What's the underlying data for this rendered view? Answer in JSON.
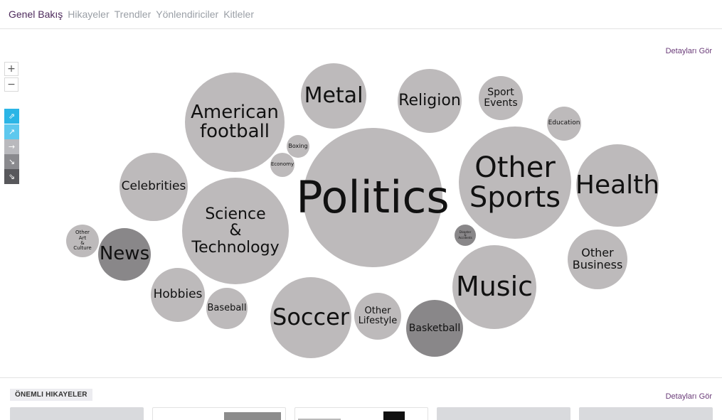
{
  "nav": {
    "tabs": [
      {
        "label": "Genel Bakış",
        "active": true
      },
      {
        "label": "Hikayeler",
        "active": false
      },
      {
        "label": "Trendler",
        "active": false
      },
      {
        "label": "Yönlendiriciler",
        "active": false
      },
      {
        "label": "Kitleler",
        "active": false
      }
    ]
  },
  "bubble_map": {
    "details_label": "Detayları Gör",
    "zoom_in_icon": "plus-icon",
    "zoom_out_icon": "minus-icon",
    "trend_legend": [
      {
        "icon": "arrow-up-strong-icon",
        "color": "#2bb5e6"
      },
      {
        "icon": "arrow-up-icon",
        "color": "#5ec8ee"
      },
      {
        "icon": "arrow-flat-icon",
        "color": "#b9b9bd"
      },
      {
        "icon": "arrow-down-icon",
        "color": "#8a8a8e"
      },
      {
        "icon": "arrow-down-strong-icon",
        "color": "#58585c"
      }
    ],
    "topics": [
      {
        "label": "Politics",
        "tone": "#bdbabb"
      },
      {
        "label": "Other\nSports",
        "tone": "#bdbabb"
      },
      {
        "label": "American\nfootball",
        "tone": "#bdbabb"
      },
      {
        "label": "Science\n&\nTechnology",
        "tone": "#bdbabb"
      },
      {
        "label": "Soccer",
        "tone": "#bdbabb"
      },
      {
        "label": "Music",
        "tone": "#bdbabb"
      },
      {
        "label": "Health",
        "tone": "#bdbabb"
      },
      {
        "label": "Metal",
        "tone": "#bdbabb"
      },
      {
        "label": "Religion",
        "tone": "#bdbabb"
      },
      {
        "label": "Celebrities",
        "tone": "#bdbabb"
      },
      {
        "label": "Other\nBusiness",
        "tone": "#bdbabb"
      },
      {
        "label": "Basketball",
        "tone": "#898789"
      },
      {
        "label": "Hobbies",
        "tone": "#bdbabb"
      },
      {
        "label": "News",
        "tone": "#898789"
      },
      {
        "label": "Other\nLifestyle",
        "tone": "#bdbabb"
      },
      {
        "label": "Sport\nEvents",
        "tone": "#bdbabb"
      },
      {
        "label": "Baseball",
        "tone": "#bdbabb"
      },
      {
        "label": "Other\nArt\n&\nCulture",
        "tone": "#bdbabb"
      },
      {
        "label": "Education",
        "tone": "#bdbabb"
      },
      {
        "label": "Boxing",
        "tone": "#bdbabb"
      },
      {
        "label": "Economy",
        "tone": "#bdbabb"
      },
      {
        "label": "Disaster\n&\nAccidents",
        "tone": "#898789"
      }
    ]
  },
  "stories": {
    "section_label": "ÖNEMLI HIKAYELER",
    "details_label": "Detayları Gör"
  }
}
